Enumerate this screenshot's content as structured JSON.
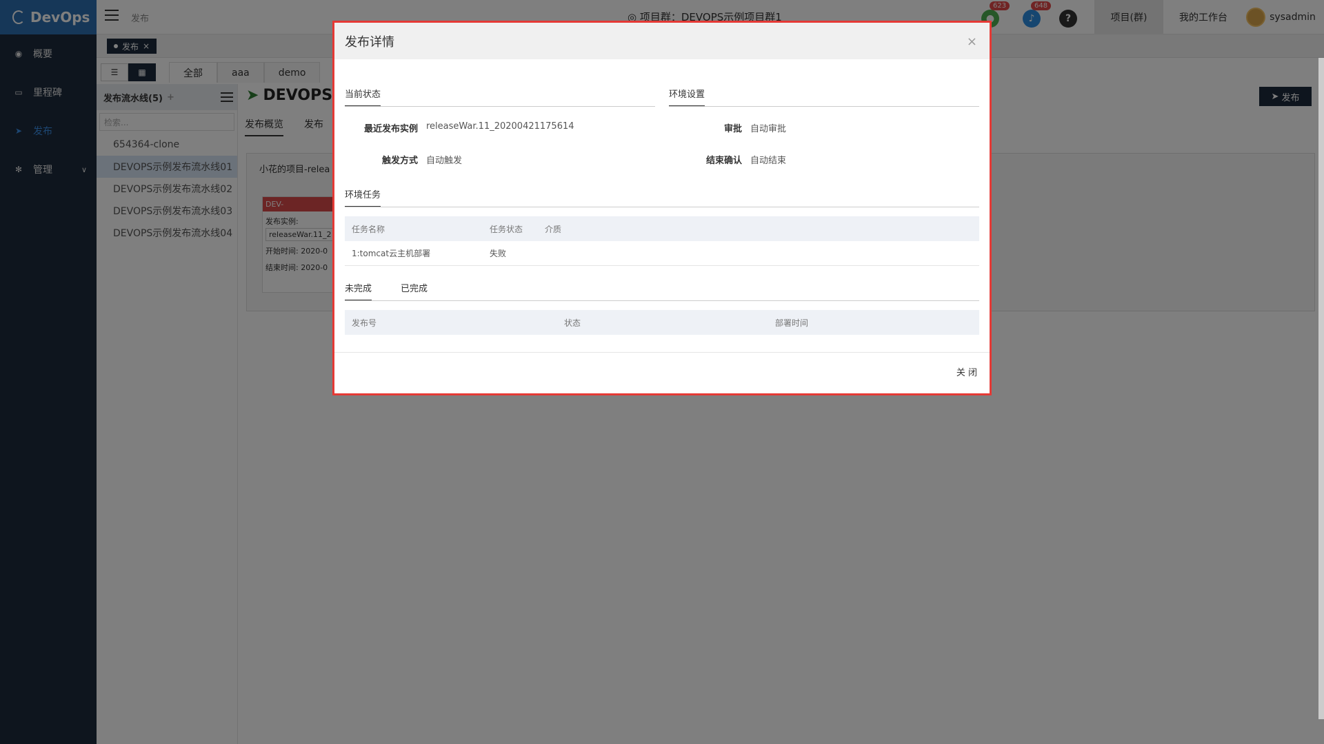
{
  "app": {
    "logo": "DevOps"
  },
  "sidebar": {
    "items": [
      {
        "label": "概要",
        "icon": "dashboard-icon"
      },
      {
        "label": "里程碑",
        "icon": "folder-icon"
      },
      {
        "label": "发布",
        "icon": "send-icon"
      },
      {
        "label": "管理",
        "icon": "gear-icon"
      }
    ]
  },
  "header": {
    "breadcrumb": "发布",
    "title": "项目群：DEVOPS示例项目群1",
    "badge_green": "623",
    "badge_blue": "648",
    "help": "?",
    "project_link": "项目(群)",
    "workspace_link": "我的工作台",
    "username": "sysadmin"
  },
  "tabbar": {
    "tab_label": "发布",
    "close": "×"
  },
  "filters": {
    "all": "全部",
    "aaa": "aaa",
    "demo": "demo"
  },
  "pipelines": {
    "title": "发布流水线(5)",
    "add": "+",
    "search_placeholder": "检索...",
    "items": [
      "654364-clone",
      "DEVOPS示例发布流水线01",
      "DEVOPS示例发布流水线02",
      "DEVOPS示例发布流水线03",
      "DEVOPS示例发布流水线04"
    ]
  },
  "main": {
    "title": "DEVOPS:",
    "publish_button": "发布",
    "tabs": [
      "发布概览",
      "发布"
    ],
    "card_title": "小花的项目-relea",
    "env_head": "DEV-",
    "env_instance_label": "发布实例:",
    "env_instance_value": "releaseWar.11_2",
    "env_start": "开始时间: 2020-0",
    "env_end": "结束时间: 2020-0"
  },
  "modal": {
    "title": "发布详情",
    "close_icon": "×",
    "current_status": {
      "tab": "当前状态",
      "latest_label": "最近发布实例",
      "latest_value": "releaseWar.11_20200421175614",
      "trigger_label": "触发方式",
      "trigger_value": "自动触发"
    },
    "env_settings": {
      "tab": "环境设置",
      "approval_label": "审批",
      "approval_value": "自动审批",
      "end_label": "结束确认",
      "end_value": "自动结束"
    },
    "env_tasks": {
      "tab": "环境任务",
      "headers": [
        "任务名称",
        "任务状态",
        "介质"
      ],
      "rows": [
        [
          "1:tomcat云主机部署",
          "失败",
          ""
        ]
      ]
    },
    "deploy": {
      "tabs": [
        "未完成",
        "已完成"
      ],
      "headers": [
        "发布号",
        "状态",
        "部署时间"
      ]
    },
    "close_button": "关 闭"
  }
}
